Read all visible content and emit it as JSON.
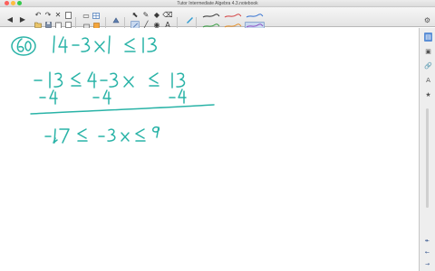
{
  "window": {
    "title": "Tutor Intermediate Algebra 4.3.notebook"
  },
  "toolbar": {
    "nav_prev": "◀",
    "nav_next": "▶",
    "undo": "↶",
    "redo": "↷",
    "delete": "✕",
    "screen": "▭",
    "select": "⬉",
    "pen": "✎",
    "eraser": "⌫",
    "lines": "╱",
    "shapes": "◆",
    "fill": "◉",
    "text": "A",
    "settings": "⚙"
  },
  "sidebar": {
    "page_sorter": "▤",
    "gallery": "▣",
    "attachments": "🔗",
    "properties": "A",
    "addons": "★",
    "nav_back": "↞",
    "nav_prev": "←",
    "nav_next": "→"
  },
  "colors": {
    "ink": "#29b3a7",
    "selected_tool": "#c9d9ef",
    "active_tab": "#5b8fd6"
  }
}
